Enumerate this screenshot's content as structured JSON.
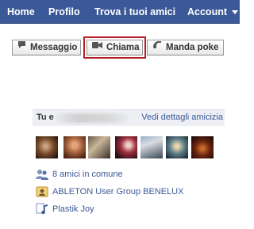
{
  "nav": {
    "home": "Home",
    "profile": "Profilo",
    "find_friends": "Trova i tuoi amici",
    "account": "Account"
  },
  "actions": {
    "message": "Messaggio",
    "call": "Chiama",
    "poke": "Manda poke"
  },
  "friendship": {
    "you_label": "Tu e",
    "details_link": "Vedi dettagli amicizia",
    "mutual_friends": "8 amici in comune",
    "group": "ABLETON User Group BENELUX",
    "page": "Plastik Joy"
  },
  "colors": {
    "nav_bg": "#3b5998",
    "link": "#3b5998",
    "highlight": "#b21e24",
    "header_bg": "#edeff4"
  },
  "icons": {
    "message": "speech-bubble-icon",
    "call": "video-camera-icon",
    "poke": "poke-hand-icon",
    "mutual_friends": "people-icon",
    "group": "group-icon",
    "page": "music-page-icon"
  }
}
